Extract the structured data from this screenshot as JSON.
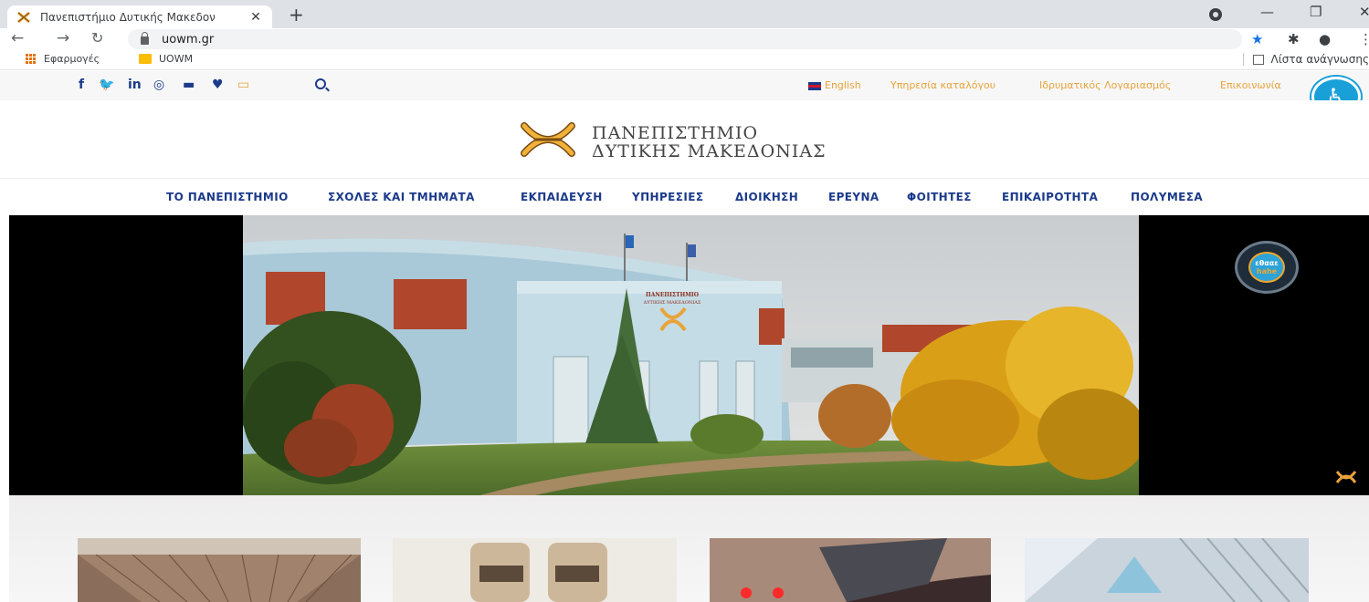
{
  "browser": {
    "tab_title": "Πανεπιστήμιο Δυτικής Μακεδον",
    "url": "uowm.gr",
    "bookmarks": [
      {
        "label": "Εφαρμογές",
        "icon": "apps-grid-icon"
      },
      {
        "label": "UOWM",
        "icon": "folder-icon"
      }
    ],
    "reading_list_label": "Λίστα ανάγνωσης"
  },
  "site": {
    "social_icons": [
      "facebook-icon",
      "twitter-icon",
      "linkedin-icon",
      "instagram-icon",
      "youtube-icon",
      "location-icon",
      "tv-icon",
      "search-icon"
    ],
    "top_links": {
      "english": "English",
      "catalog": "Υπηρεσία καταλόγου",
      "account": "Ιδρυματικός Λογαριασμός",
      "contact": "Επικοινωνία"
    },
    "logo_line1": "ΠΑΝΕΠΙΣΤΗΜΙΟ",
    "logo_line2": "ΔΥΤΙΚΗΣ ΜΑΚΕΔΟΝΙΑΣ",
    "nav": [
      "ΤΟ ΠΑΝΕΠΙΣΤΗΜΙΟ",
      "ΣΧΟΛΕΣ ΚΑΙ ΤΜΗΜΑΤΑ",
      "ΕΚΠΑΙΔΕΥΣΗ",
      "ΥΠΗΡΕΣΙΕΣ",
      "ΔΙΟΙΚΗΣΗ",
      "ΕΡΕΥΝΑ",
      "ΦΟΙΤΗΤΕΣ",
      "ΕΠΙΚΑΙΡΟΤΗΤΑ",
      "ΠΟΛΥΜΕΣΑ"
    ],
    "hero_sign_line1": "ΠΑΝΕΠΙΣΤΗΜΙΟ",
    "hero_sign_line2": "ΔΥΤΙΚΗΣ ΜΑΚΕΔΟΝΙΑΣ",
    "badge": {
      "line1": "εθααε",
      "line2": "hahe"
    },
    "colors": {
      "brand_blue": "#1b3a8a",
      "accent_orange": "#e8a33a",
      "accessibility_blue": "#1aa0d8"
    }
  }
}
